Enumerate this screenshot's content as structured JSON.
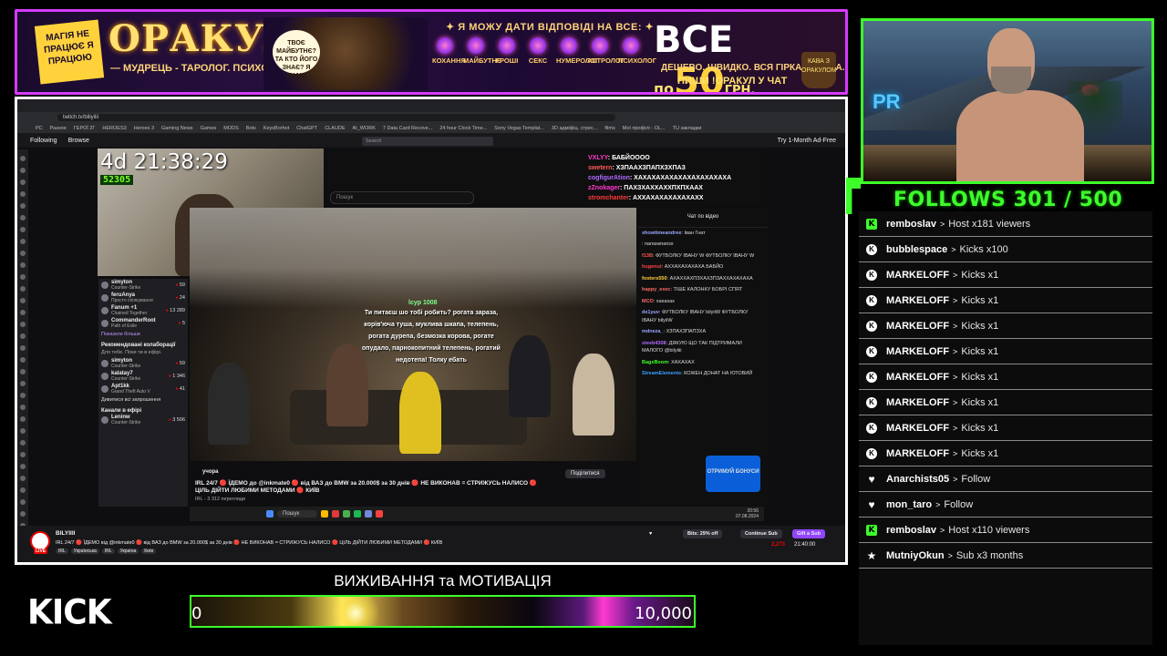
{
  "colors": {
    "accent": "#3dff2a",
    "banner_border": "#d63bff",
    "event_divider": "#8a8a8a"
  },
  "banner": {
    "badge": "МАГІЯ НЕ ПРАЦЮЄ Я ПРАЦЮЮ",
    "title": "ОРАКУЛ",
    "subtitle": "— МУДРЕЦЬ - ТАРОЛОГ. ПСИХОЛОГ. —",
    "bubble": "ТВОЄ МАЙБУТНЄ? ТА КТО ЙОГО ЗНАЄ? Я ЗНАЮ",
    "tagline": "✦ Я МОЖУ ДАТИ ВІДПОВІДІ НА ВСЕ: ✦",
    "categories": [
      "КОХАННЯ",
      "МАЙБУТНЄ",
      "ГРОШІ",
      "СЕКС",
      "НУМЕРОЛОГ",
      "АСТРОЛОГ",
      "ПСИХОЛОГ"
    ],
    "price_prefix": "ВСЕ",
    "price_po": "по",
    "price_amount": "50",
    "price_currency": "ГРН.",
    "price_sub": "ДЕШЕВО. ШВИДКО. ВСЯ ГІРКА ПРАВДА.",
    "price_cta": "ПИШИ !ОРАКУЛ У ЧАТ",
    "cup_text": "КАВА З ОРАКУЛОМ"
  },
  "screen": {
    "url": "twitch.tv/biliyilii",
    "bookmarks": [
      "PC",
      "Разное",
      "ГЕРОЇ 2Г",
      "HEROES3",
      "Heroes 3",
      "Gaming News",
      "Games",
      "MODS",
      "Bots",
      "KeysBorhot",
      "ChatGPT",
      "CLAUDE",
      "AI_WORK",
      "7 Data Card Recove...",
      "24 hour Clock Time...",
      "Sony Vegas Templat...",
      "3D адміфіц. стрес...",
      "films",
      "Мої профілі - OL...",
      "TU закладки"
    ],
    "twitch_nav": {
      "following": "Following",
      "browse": "Browse",
      "search_placeholder": "Search",
      "ad_free": "Try 1-Month Ad-Free"
    },
    "timer": "4d 21:38:29",
    "sub_count": "52305",
    "sidebar": {
      "live_channels": [
        {
          "name": "simyton",
          "game": "Counter-Strike",
          "viewers": "59"
        },
        {
          "name": "feruAnya",
          "game": "Просто спілкування",
          "viewers": "24"
        },
        {
          "name": "Fanum +1",
          "game": "Chained Together",
          "viewers": "13 289"
        },
        {
          "name": "CommanderRoot",
          "game": "Path of Exile",
          "viewers": "5"
        }
      ],
      "show_more": "Показати більше",
      "collab_header": "Рекомендовані колаборації",
      "collab_sub": "Для тебе. Поки ти в ефірі.",
      "collab_channels": [
        {
          "name": "simyton",
          "game": "Counter-Strike",
          "viewers": "59"
        },
        {
          "name": "kalatay7",
          "game": "Counter-Strike",
          "viewers": "1 346"
        },
        {
          "name": "Apt1kk",
          "game": "Grand Theft Auto V",
          "viewers": "41"
        }
      ],
      "see_invited": "Дивитися всі запрошення",
      "channels_header": "Канали в ефірі",
      "channels": [
        {
          "name": "Leninw",
          "game": "Counter-Strike",
          "viewers": "3 506"
        }
      ]
    },
    "youtube": {
      "search_placeholder": "Пошук",
      "overlay_chat": [
        {
          "user": "VXLYY",
          "text": ": БАБЙОООО"
        },
        {
          "user": "swetern",
          "text": ": ХЗПААХЗПАПХЗХПАЗ"
        },
        {
          "user": "cogfigurAtion",
          "text": ": ХАХАХАХАХАХАХАХАХАХАХА"
        },
        {
          "user": "zZnokager",
          "text": ": ПАХЗХАХХАХХПХПХААХ"
        },
        {
          "user": "stromchanter",
          "text": ": АХХАХАХАХАХАХАХХ"
        }
      ]
    },
    "video_overlay": {
      "user": "lcyp 1008",
      "text": "Ти питаєш шо тобі робить? рогата зараза, корів'юча туша, муклива шкапа, телепень, рогата дурепа, безмозка корова, рогате опудало, парнокопитний телепень, рогатий недотепа! Толку ебать"
    },
    "stream_info": {
      "channel": "учора",
      "title": "IRL 24/7 🔴 ЇДЕМО до @inkmate0 🔴 від ВАЗ до BMW за 20.000$ за 30 днів 🔴 НЕ ВИКОНАВ = СТРИЖУСЬ НАЛИСО 🔴 ЦІЛЬ ДІЙТИ ЛЮБИМИ МЕТОДАМИ 🔴 КИЇВ",
      "views": "IRL - 3 312 перегляди",
      "share": "Поділитися"
    },
    "twitch_chat": {
      "header": "Чат по відео",
      "messages": [
        {
          "user": "showtimeandree",
          "text": ": Іван Гнат",
          "color": "#9aa6ff"
        },
        {
          "user": "",
          "text": ": папахкпапзх",
          "color": "#4f6bff"
        },
        {
          "user": "f13B",
          "text": ": ФУТБОЛКУ ІВАНУ W ФУТБОЛКУ ІВАНУ W",
          "color": "#ff4f4f"
        },
        {
          "user": "hugenut",
          "text": ": АХХАХАХАХАХА БАБЙО",
          "color": "#ff4040"
        },
        {
          "user": "fosters550",
          "text": ": АХАХХАХПЗХАХЗПЗАХХАХАХАХА",
          "color": "#ffd23c"
        },
        {
          "user": "happy_exec",
          "text": ": ТІШЕ КАЛОНКУ БОБРІ СПЯТ",
          "color": "#ff6a6a"
        },
        {
          "user": "MCO",
          "text": ": хахахах",
          "color": "#ff6a6a"
        },
        {
          "user": "de1yuv",
          "text": ": ФУТБОЛКУ ІВАНУ bilyiiW ФУТБОЛКУ ІВАНУ bilyiiW",
          "color": "#9aa6ff"
        },
        {
          "user": "mdneza_",
          "text": ": ХЗПАХЗПАПЗХА",
          "color": "#9aa6ff"
        },
        {
          "user": "steeb4308",
          "text": ": ДЯКУЮ ЩО ТАК ПІДТРИМАЛИ МАЛОГО @bilyiiii",
          "color": "#b06aff"
        },
        {
          "user": "BagsBoom",
          "text": ": ХАХАХАХ",
          "color": "#3dff2a"
        },
        {
          "user": "StreamElements",
          "text": ": КОЖЕН ДОНАТ НА ЮТОВИЙ",
          "color": "#3aa0ff"
        }
      ],
      "bonus_label": "ОТРИМУЙ БОНУСИ"
    },
    "taskbar": {
      "search": "Пошук",
      "time": "20:56",
      "date": "07.08.2024"
    },
    "footer": {
      "channel": "BILYIIII",
      "live": "LIVE",
      "title": "IRL 24/7 🔴 ЇДЕМО від @inkmate0 🔴 від ВАЗ до BMW за 20.000$ за 30 днів 🔴 НЕ ВИКОНАВ = СТРИЖУСЬ НАЛИСО 🔴 ЦІЛЬ ДІЙТИ ЛЮБИМИ МЕТОДАМИ 🔴 КИЇВ",
      "tags": [
        "IRL",
        "Українська",
        "IRL",
        "Україна",
        "Київ"
      ],
      "bits_offer": "Bits: 29% off",
      "continue_sub": "Continue Sub",
      "gift_sub": "Gift a Sub",
      "viewers": "2,273",
      "uptime": "21:40:00"
    }
  },
  "follows": {
    "text": "FOLLOWS 301 / 500"
  },
  "events": [
    {
      "icon": "kick-icon",
      "user": "remboslav",
      "action": "Host x181 viewers"
    },
    {
      "icon": "kicks-coin-icon",
      "user": "bubblespace",
      "action": "Kicks x100"
    },
    {
      "icon": "kicks-coin-icon",
      "user": "MARKELOFF",
      "action": "Kicks x1"
    },
    {
      "icon": "kicks-coin-icon",
      "user": "MARKELOFF",
      "action": "Kicks x1"
    },
    {
      "icon": "kicks-coin-icon",
      "user": "MARKELOFF",
      "action": "Kicks x1"
    },
    {
      "icon": "kicks-coin-icon",
      "user": "MARKELOFF",
      "action": "Kicks x1"
    },
    {
      "icon": "kicks-coin-icon",
      "user": "MARKELOFF",
      "action": "Kicks x1"
    },
    {
      "icon": "kicks-coin-icon",
      "user": "MARKELOFF",
      "action": "Kicks x1"
    },
    {
      "icon": "kicks-coin-icon",
      "user": "MARKELOFF",
      "action": "Kicks x1"
    },
    {
      "icon": "kicks-coin-icon",
      "user": "MARKELOFF",
      "action": "Kicks x1"
    },
    {
      "icon": "heart-icon",
      "user": "Anarchists05",
      "action": "Follow"
    },
    {
      "icon": "heart-icon",
      "user": "mon_taro",
      "action": "Follow"
    },
    {
      "icon": "kick-icon",
      "user": "remboslav",
      "action": "Host x110 viewers"
    },
    {
      "icon": "star-icon",
      "user": "MutniyOkun",
      "action": "Sub x3 months"
    }
  ],
  "goal": {
    "title": "ВИЖИВАННЯ та МОТИВАЦІЯ",
    "min": "0",
    "max": "10,000"
  },
  "kick_logo": "KICK"
}
